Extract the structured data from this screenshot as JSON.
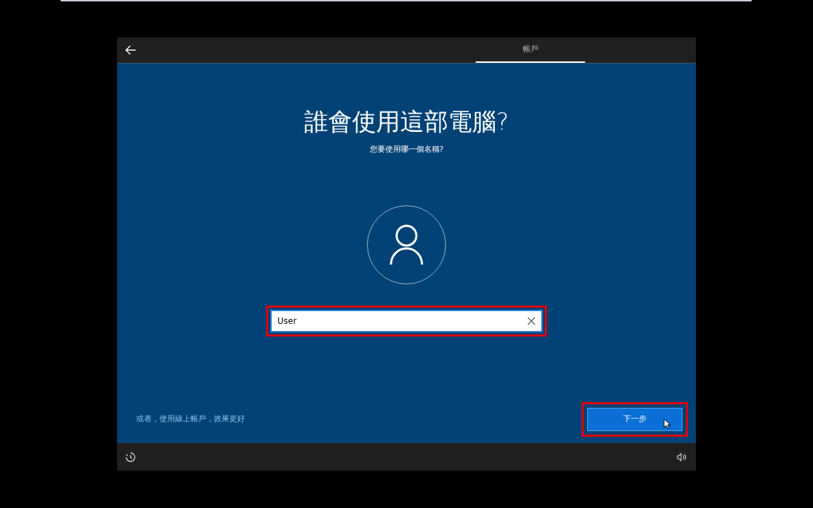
{
  "header": {
    "tabs": [
      {
        "label": "帳戶",
        "selected": true
      }
    ]
  },
  "title": "誰會使用這部電腦?",
  "subtitle": "您要使用哪一個名稱?",
  "name_field": {
    "value": "User",
    "highlighted": true
  },
  "alternative_link": "或者，使用線上帳戶，效果更好",
  "next_button": {
    "label": "下一步",
    "highlighted": true
  }
}
